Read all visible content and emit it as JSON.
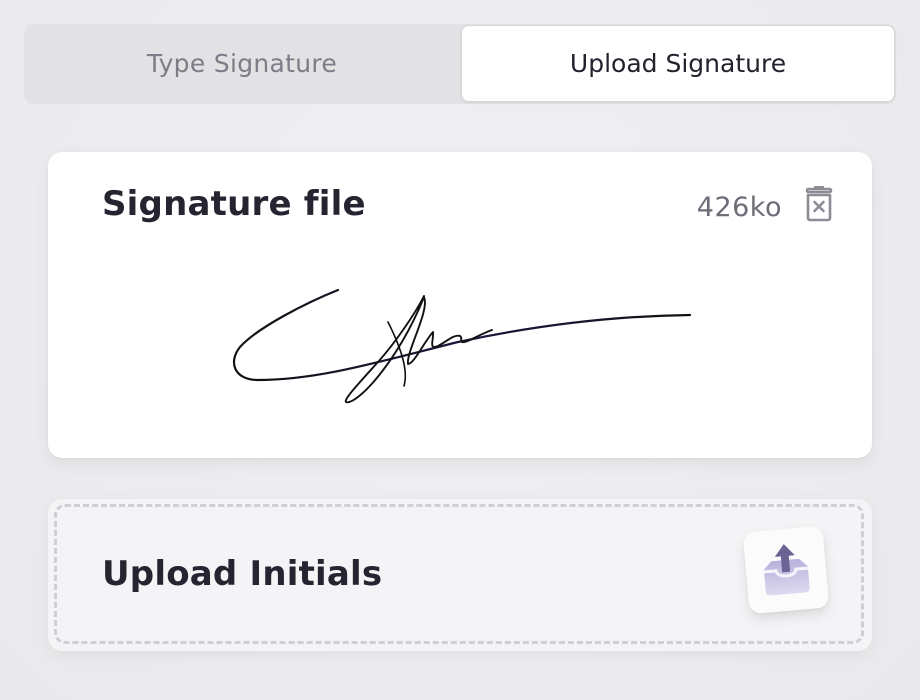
{
  "tabs": {
    "type_label": "Type Signature",
    "upload_label": "Upload Signature",
    "active": "upload"
  },
  "signature_card": {
    "title": "Signature file",
    "file_size": "426ko",
    "delete_icon": "trash-icon"
  },
  "initials_card": {
    "title": "Upload Initials",
    "upload_icon": "upload-tray-icon"
  },
  "colors": {
    "text_dark": "#262430",
    "text_muted": "#6e6c76",
    "icon_accent": "#6b6394",
    "icon_accent_light": "#c9c3e6"
  }
}
